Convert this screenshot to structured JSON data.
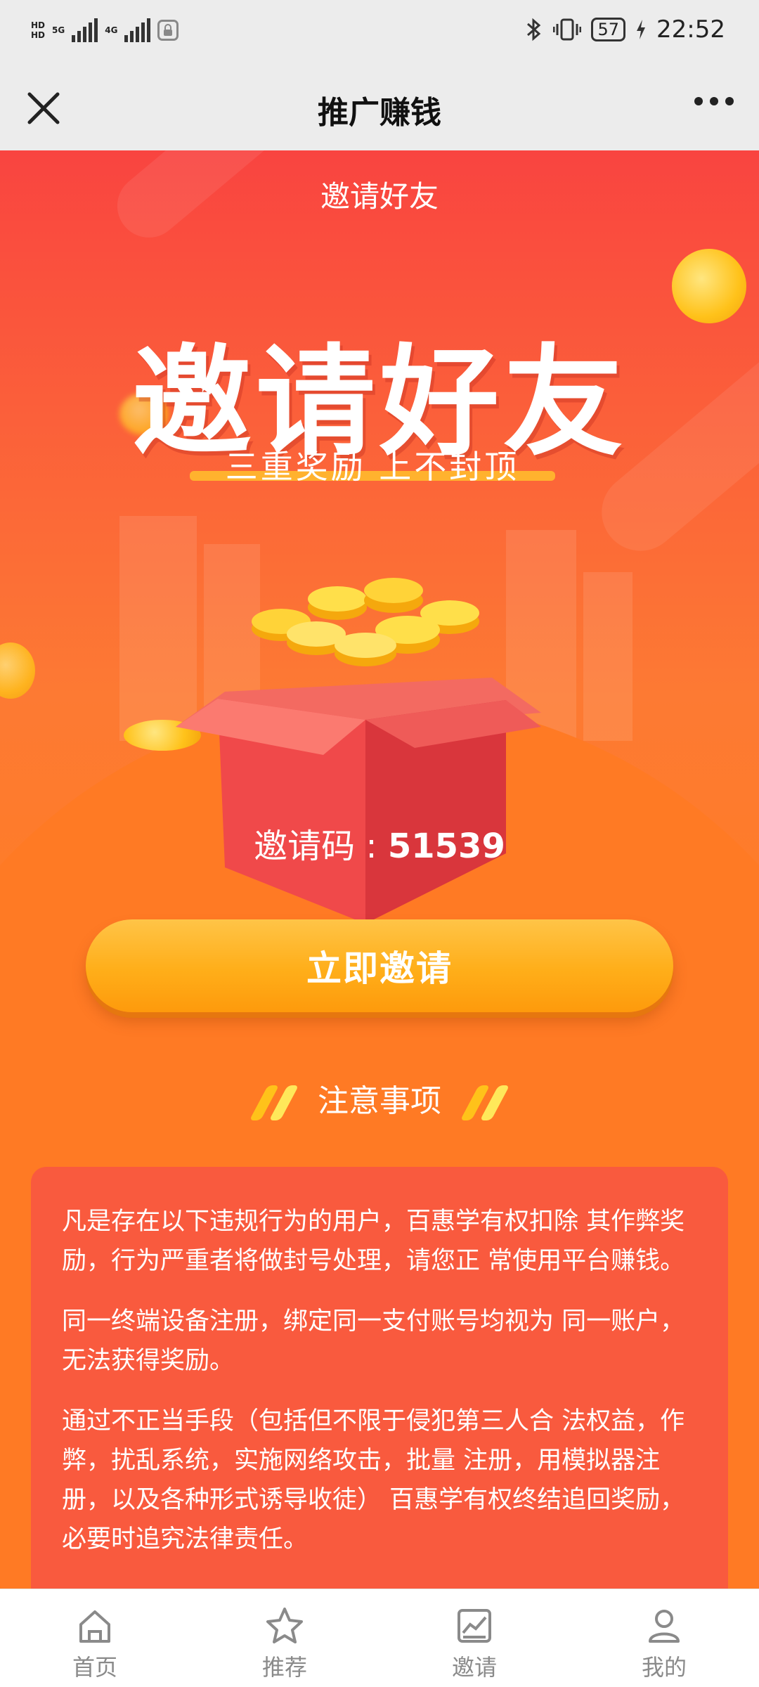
{
  "status_bar": {
    "time": "22:52",
    "battery": "57",
    "network_top": "5G",
    "network_bottom": "4G",
    "hd1": "HD",
    "hd2": "HD"
  },
  "topbar": {
    "title": "推广赚钱"
  },
  "hero": {
    "header_label": "邀请好友",
    "headline": "邀请好友",
    "subtitle": "三重奖励 上不封顶"
  },
  "invite": {
    "code_label": "邀请码 : ",
    "code_value": "51539",
    "button_label": "立即邀请"
  },
  "notice": {
    "title": "注意事项",
    "paragraphs": [
      "凡是存在以下违规行为的用户，百惠学有权扣除 其作弊奖励，行为严重者将做封号处理，请您正 常使用平台赚钱。",
      "同一终端设备注册，绑定同一支付账号均视为 同一账户，无法获得奖励。",
      "通过不正当手段（包括但不限于侵犯第三人合 法权益，作弊，扰乱系统，实施网络攻击，批量 注册，用模拟器注册，以及各种形式诱导收徒） 百惠学有权终结追回奖励，必要时追究法律责任。"
    ]
  },
  "bottom_nav": {
    "items": [
      {
        "label": "首页",
        "icon": "home-icon"
      },
      {
        "label": "推荐",
        "icon": "star-icon"
      },
      {
        "label": "邀请",
        "icon": "chart-icon"
      },
      {
        "label": "我的",
        "icon": "user-icon"
      }
    ]
  },
  "colors": {
    "accent_red": "#f94440",
    "orange": "#ff7a1f",
    "button_gold": "#ffae19"
  }
}
